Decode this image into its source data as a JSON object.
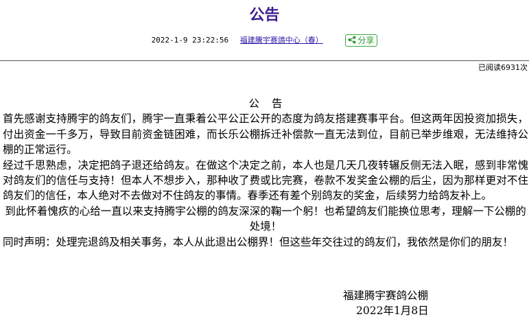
{
  "header": {
    "title": "公告",
    "datetime": "2022-1-9 23:22:56",
    "author": "福建騰宇赛鴿中心（春）",
    "share_label": "分享"
  },
  "stats": {
    "read_count": "已阅读6931次"
  },
  "article": {
    "heading": "公告",
    "p1": "首先感谢支持腾宇的鸽友们，腾宇一直秉着公平公正公开的态度为鸽友搭建赛事平台。但这两年因投资加损失，付出资金一千多万，导致目前资金链困难，而长乐公棚拆迁补偿款一直无法到位，目前已举步维艰，无法维持公棚的正常运行。",
    "p2": "经过千思熟虑，决定把鸽子退还给鸽友。在做这个决定之前，本人也是几天几夜转辗反侧无法入眠，感到非常愧对鸽友们的信任与支持！但本人不想步入，那种收了费或比完赛，卷款不发奖金公棚的后尘，因为那样更对不住鸽友们的信任，本人绝对不去做对不住鸽友的事情。春季还有差个别鸽友的奖金，后续努力给鸽友补上。",
    "p3": "到此怀着愧疚的心给一直以来支持腾宇公棚的鸽友深深的鞠一个躬！也希望鸽友们能换位思考，理解一下公棚的处境！",
    "p4": "同时声明：处理完退鸽及相关事务，本人从此退出公棚界！但这些年交往过的鸽友们，我依然是你们的朋友！",
    "signature": "福建腾宇赛鸽公棚",
    "date": "2022年1月8日"
  }
}
